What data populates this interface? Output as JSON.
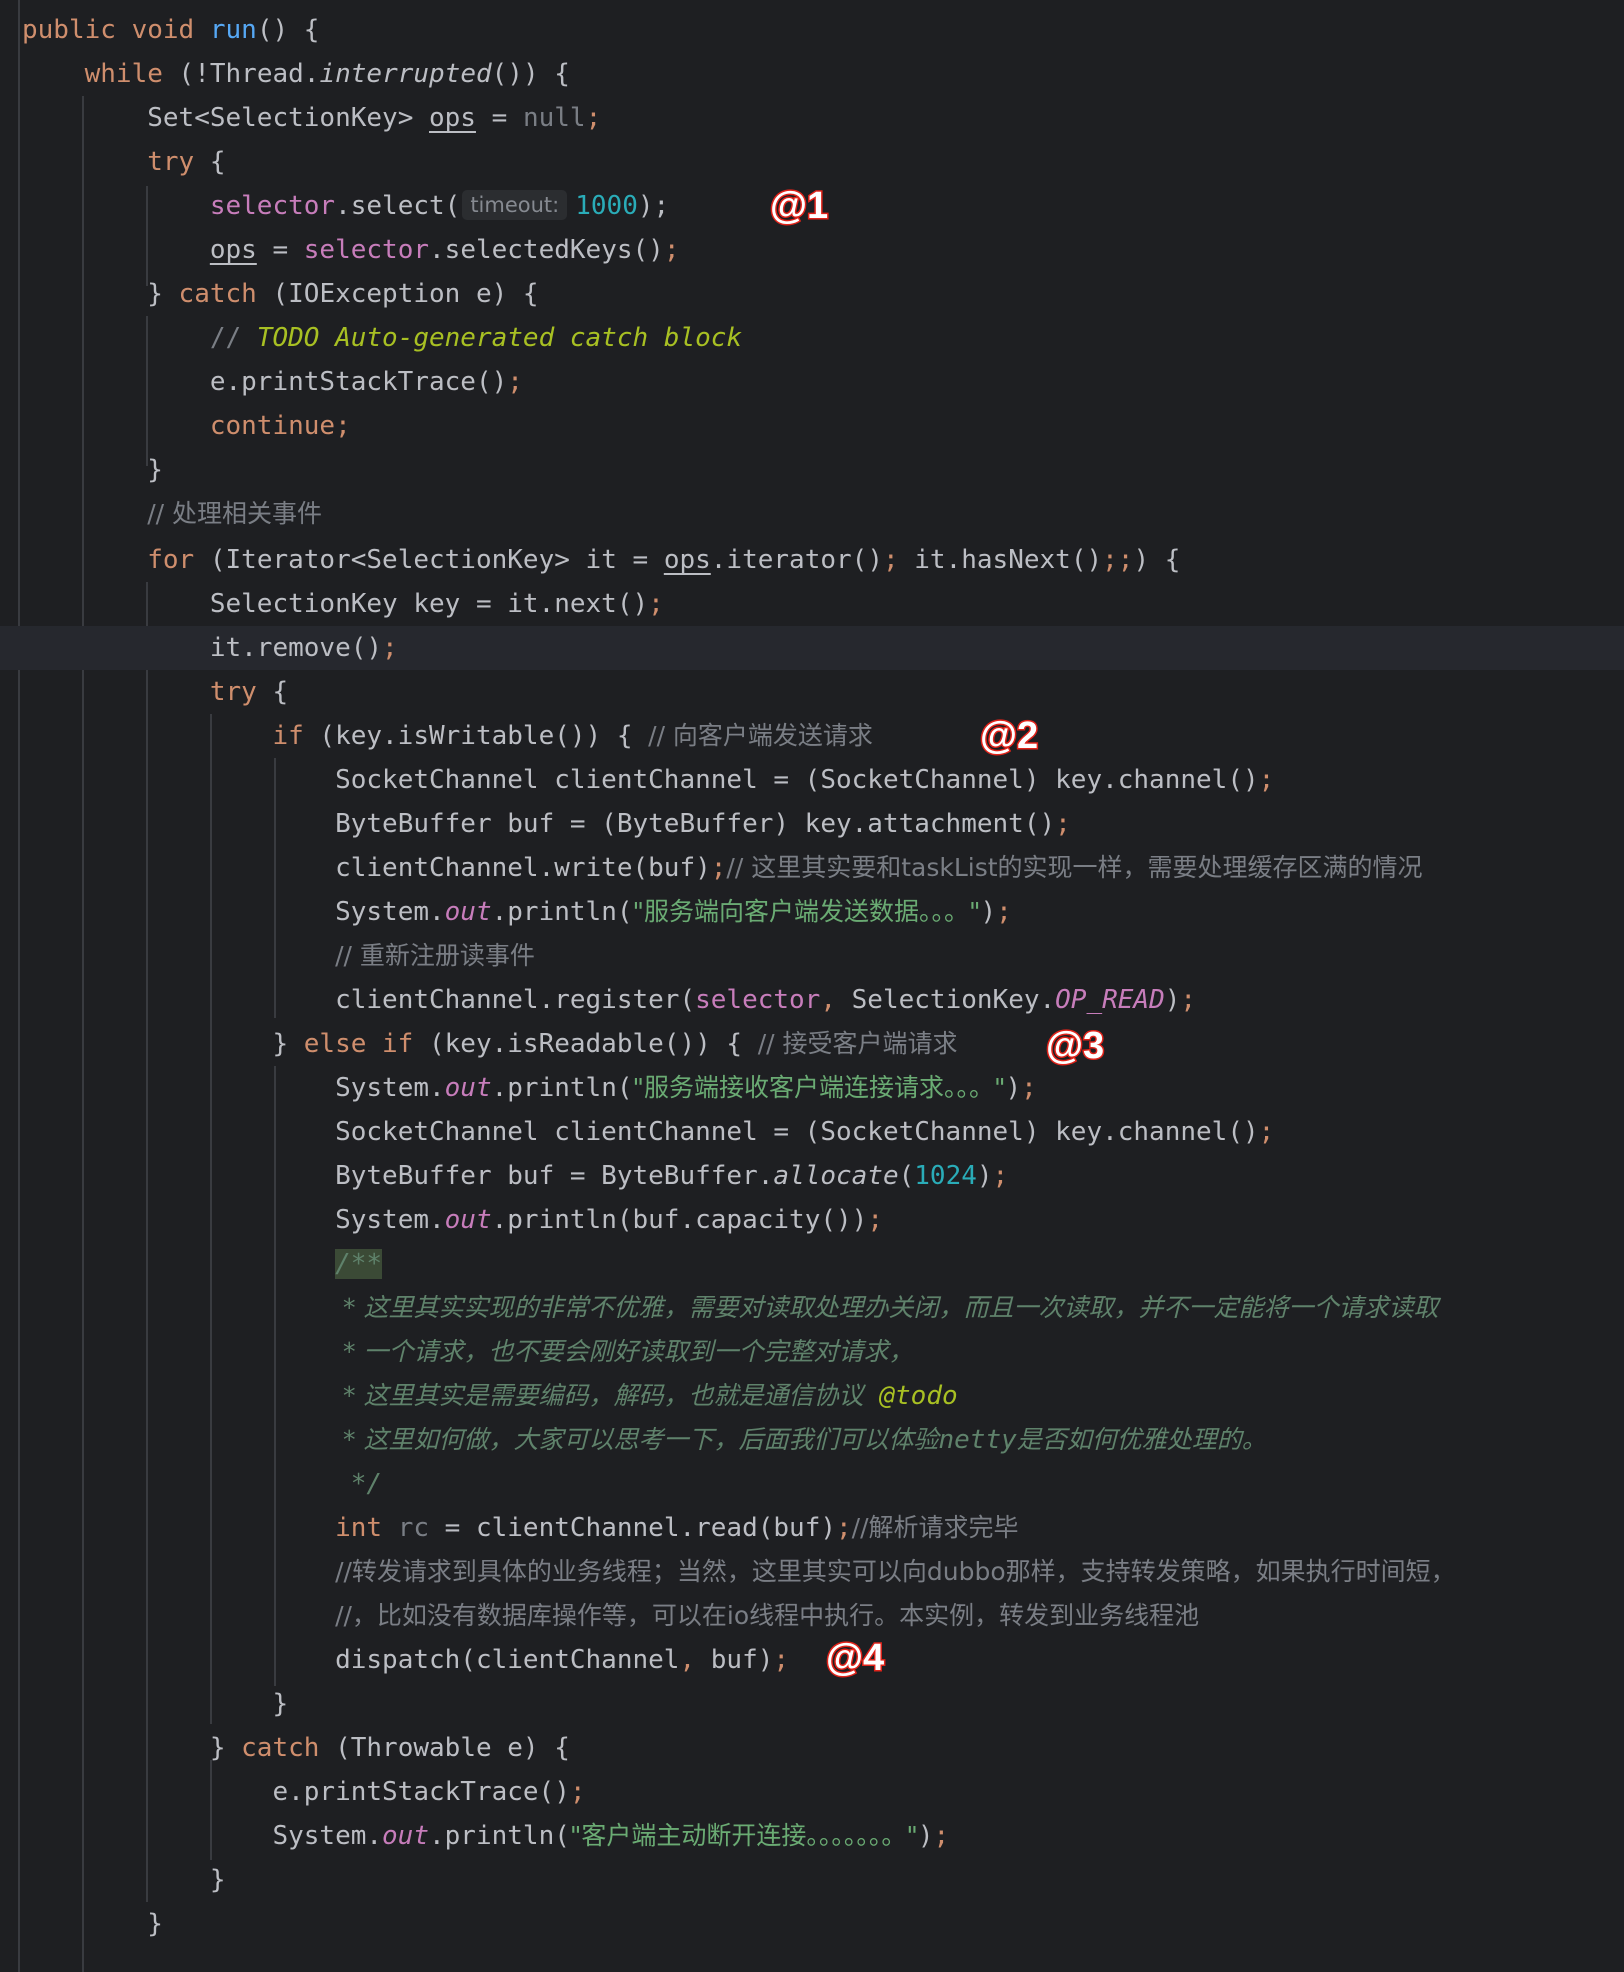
{
  "editor": {
    "parameter_hint": "timeout:",
    "lines": {
      "l01": {
        "a": "public",
        "b": " ",
        "c": "void",
        "d": " ",
        "e": "run",
        "f": "() {"
      },
      "l02": {
        "a": "while",
        "b": " (!Thread.",
        "c": "interrupted",
        "d": "()) {"
      },
      "l03": {
        "a": "Set<SelectionKey> ",
        "b": "ops",
        "c": " = ",
        "d": "null",
        "e": ";"
      },
      "l04": {
        "a": "try",
        "b": " {"
      },
      "l05": {
        "a": "selector",
        "b": ".select(",
        "c": "1000",
        "d": ");"
      },
      "l06": {
        "a": "ops",
        "b": " = ",
        "c": "selector",
        "d": ".selectedKeys()",
        "e": ";"
      },
      "l07": {
        "a": "} ",
        "b": "catch",
        "c": " (IOException e) {"
      },
      "l08": {
        "a": "// ",
        "b": "TODO Auto-generated catch block"
      },
      "l09": {
        "a": "e.printStackTrace()",
        "b": ";"
      },
      "l10": {
        "a": "continue",
        "b": ";"
      },
      "l11": {
        "a": "}"
      },
      "l12": {
        "a": "// 处理相关事件"
      },
      "l13": {
        "a": "for",
        "b": " (Iterator<SelectionKey> it = ",
        "c": "ops",
        "d": ".iterator()",
        "e": "; ",
        "f": "it.hasNext()",
        "g": ";;",
        "h": ") {"
      },
      "l14": {
        "a": "SelectionKey key = it.next()",
        "b": ";"
      },
      "l15": {
        "a": "it.remove()",
        "b": ";"
      },
      "l16": {
        "a": "try",
        "b": " {"
      },
      "l17": {
        "a": "if",
        "b": " (key.isWritable()) { ",
        "c": "// 向客户端发送请求"
      },
      "l18": {
        "a": "SocketChannel clientChannel = (SocketChannel) key.channel()",
        "b": ";"
      },
      "l19": {
        "a": "ByteBuffer buf = (ByteBuffer) key.attachment()",
        "b": ";"
      },
      "l20": {
        "a": "clientChannel.write(buf)",
        "b": ";",
        "c": "// 这里其实要和taskList的实现一样，需要处理缓存区满的情况"
      },
      "l21": {
        "a": "System.",
        "b": "out",
        "c": ".println(",
        "d": "\"服务端向客户端发送数据。。。\"",
        "e": ")",
        "f": ";"
      },
      "l22": {
        "a": "// 重新注册读事件"
      },
      "l23": {
        "a": "clientChannel.register(",
        "b": "selector",
        "c": ", ",
        "d": "SelectionKey.",
        "e": "OP_READ",
        "f": ")",
        "g": ";"
      },
      "l24": {
        "a": "} ",
        "b": "else if",
        "c": " (key.isReadable()) { ",
        "d": "// 接受客户端请求"
      },
      "l25": {
        "a": "System.",
        "b": "out",
        "c": ".println(",
        "d": "\"服务端接收客户端连接请求。。。\"",
        "e": ")",
        "f": ";"
      },
      "l26": {
        "a": "SocketChannel clientChannel = (SocketChannel) key.channel()",
        "b": ";"
      },
      "l27": {
        "a": "ByteBuffer buf = ByteBuffer.",
        "b": "allocate",
        "c": "(",
        "d": "1024",
        "e": ")",
        "f": ";"
      },
      "l28": {
        "a": "System.",
        "b": "out",
        "c": ".println(buf.capacity())",
        "d": ";"
      },
      "l29": {
        "a": "/**"
      },
      "l30": {
        "a": " * 这里其实实现的非常不优雅，需要对读取处理办关闭，而且一次读取，并不一定能将一个请求读取"
      },
      "l31": {
        "a": " * 一个请求，也不要会刚好读取到一个完整对请求，"
      },
      "l32": {
        "a": " * 这里其实是需要编码，解码，也就是通信协议  ",
        "b": "@todo"
      },
      "l33": {
        "a": " * 这里如何做，大家可以思考一下，后面我们可以体验",
        "b": "netty",
        "c": "是否如何优雅处理的。"
      },
      "l34": {
        "a": " */"
      },
      "l35": {
        "a": "int",
        "b": " ",
        "c": "rc",
        "d": " = clientChannel.read(buf)",
        "e": ";",
        "f": "//解析请求完毕"
      },
      "l36": {
        "a": "//转发请求到具体的业务线程；当然，这里其实可以向dubbo那样，支持转发策略，如果执行时间短，"
      },
      "l37": {
        "a": "//，比如没有数据库操作等，可以在io线程中执行。本实例，转发到业务线程池"
      },
      "l38": {
        "a": "dispatch(clientChannel",
        "b": ", ",
        "c": "buf)",
        "d": ";"
      },
      "l39": {
        "a": "}"
      },
      "l40": {
        "a": "} ",
        "b": "catch",
        "c": " (Throwable e) {"
      },
      "l41": {
        "a": "e.printStackTrace()",
        "b": ";"
      },
      "l42": {
        "a": "System.",
        "b": "out",
        "c": ".println(",
        "d": "\"客户端主动断开连接。。。。。。。\"",
        "e": ")",
        "f": ";"
      },
      "l43": {
        "a": "}"
      },
      "l44": {
        "a": "}"
      }
    }
  },
  "annotations": {
    "a1": "@1",
    "a2": "@2",
    "a3": "@3",
    "a4": "@4"
  },
  "colors": {
    "background": "#1e1f22",
    "keyword": "#cf8e6d",
    "string": "#6aab73",
    "comment": "#7a7e85",
    "number": "#2aacb8",
    "field": "#c77dbb",
    "todo": "#a8c023",
    "annotation_marker": "#e0231a"
  }
}
